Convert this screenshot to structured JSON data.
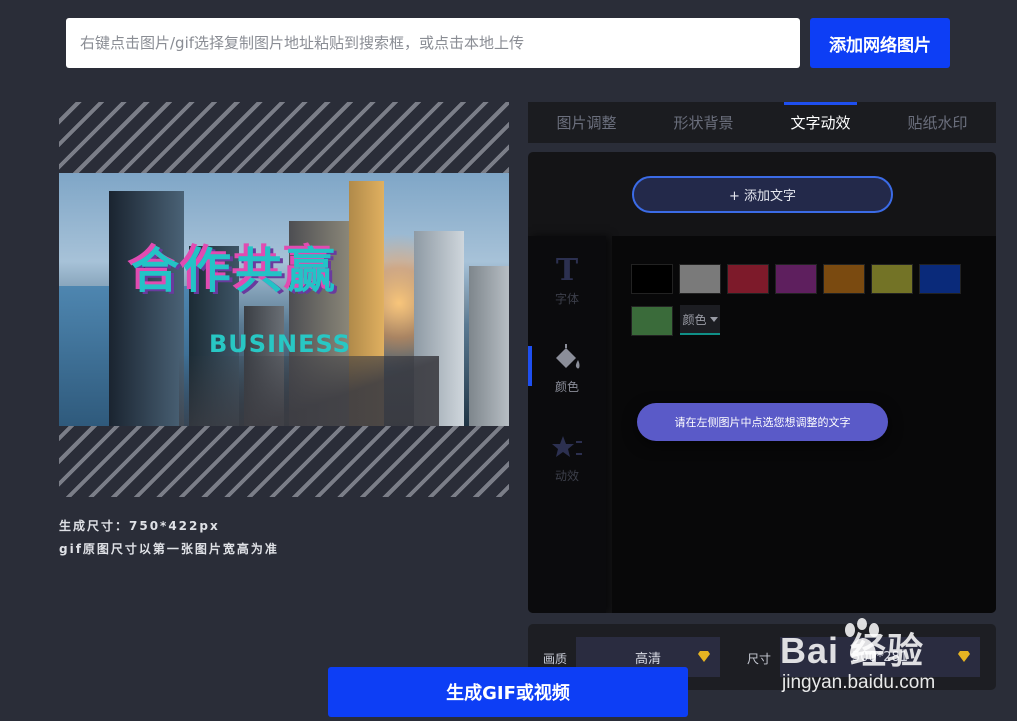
{
  "search": {
    "placeholder": "右键点击图片/gif选择复制图片地址粘贴到搜索框，或点击本地上传",
    "add_button": "添加网络图片"
  },
  "preview": {
    "headline": "合作共赢",
    "subline": "BUSINESS"
  },
  "size_info": {
    "line1": "生成尺寸：750*422px",
    "line2": "gif原图尺寸以第一张图片宽高为准"
  },
  "tabs": [
    {
      "label": "图片调整",
      "active": false
    },
    {
      "label": "形状背景",
      "active": false
    },
    {
      "label": "文字动效",
      "active": true
    },
    {
      "label": "贴纸水印",
      "active": false
    }
  ],
  "panel": {
    "add_text_button": "+ 添加文字",
    "side_nav": [
      {
        "icon": "font-icon",
        "label": "字体",
        "active": false
      },
      {
        "icon": "paint-bucket-icon",
        "label": "颜色",
        "active": true
      },
      {
        "icon": "star-animation-icon",
        "label": "动效",
        "active": false
      }
    ],
    "swatches": [
      "#000000",
      "#7a7a7a",
      "#7d1a2a",
      "#5e1f5e",
      "#7a4a10",
      "#737326",
      "#0a2a7a",
      "#3a6b3a"
    ],
    "color_select_label": "颜色",
    "hint": "请在左侧图片中点选您想调整的文字"
  },
  "bottom_bar": {
    "quality_label": "画质",
    "quality_value": "高清",
    "size_label": "尺寸",
    "size_value": "500*281"
  },
  "generate_button": "生成GIF或视频",
  "watermark": {
    "brand": "Bai 经验",
    "url": "jingyan.baidu.com"
  },
  "colors": {
    "accent_blue": "#0d3ef5",
    "background": "#2a2d38",
    "panel": "#141416",
    "hint_purple": "#5a5ac8"
  }
}
